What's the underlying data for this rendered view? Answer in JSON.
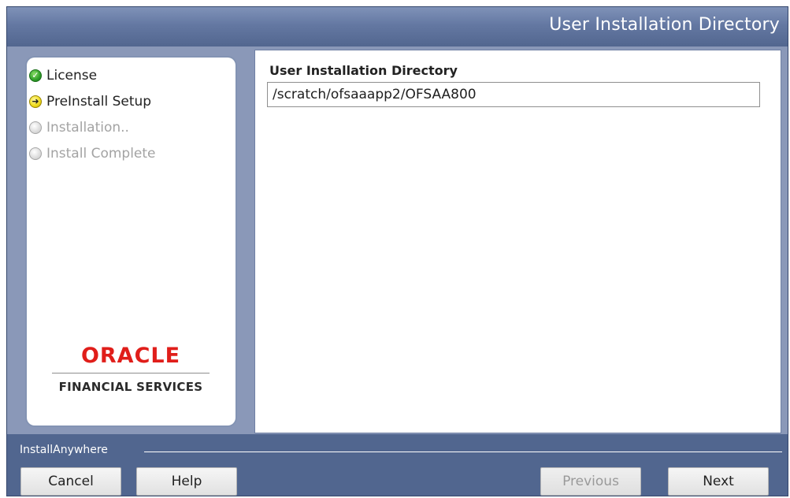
{
  "window": {
    "title": "User Installation Directory"
  },
  "sidebar": {
    "steps": [
      {
        "label": "License",
        "state": "complete",
        "icon": "checkmark-icon"
      },
      {
        "label": "PreInstall Setup",
        "state": "current",
        "icon": "arrow-right-icon"
      },
      {
        "label": "Installation..",
        "state": "pending",
        "icon": "empty-circle-icon"
      },
      {
        "label": "Install Complete",
        "state": "pending",
        "icon": "empty-circle-icon"
      }
    ],
    "logo": {
      "brand": "ORACLE",
      "tagline": "FINANCIAL SERVICES"
    }
  },
  "main": {
    "field_label": "User Installation Directory",
    "field_value": "/scratch/ofsaaapp2/OFSAA800"
  },
  "footer": {
    "brand": "InstallAnywhere",
    "buttons": {
      "cancel": "Cancel",
      "help": "Help",
      "previous": "Previous",
      "next": "Next"
    }
  },
  "colors": {
    "accent_red": "#e01e1a",
    "window_blue": "#4a5f8a",
    "title_gradient_top": "#7f92b8"
  }
}
